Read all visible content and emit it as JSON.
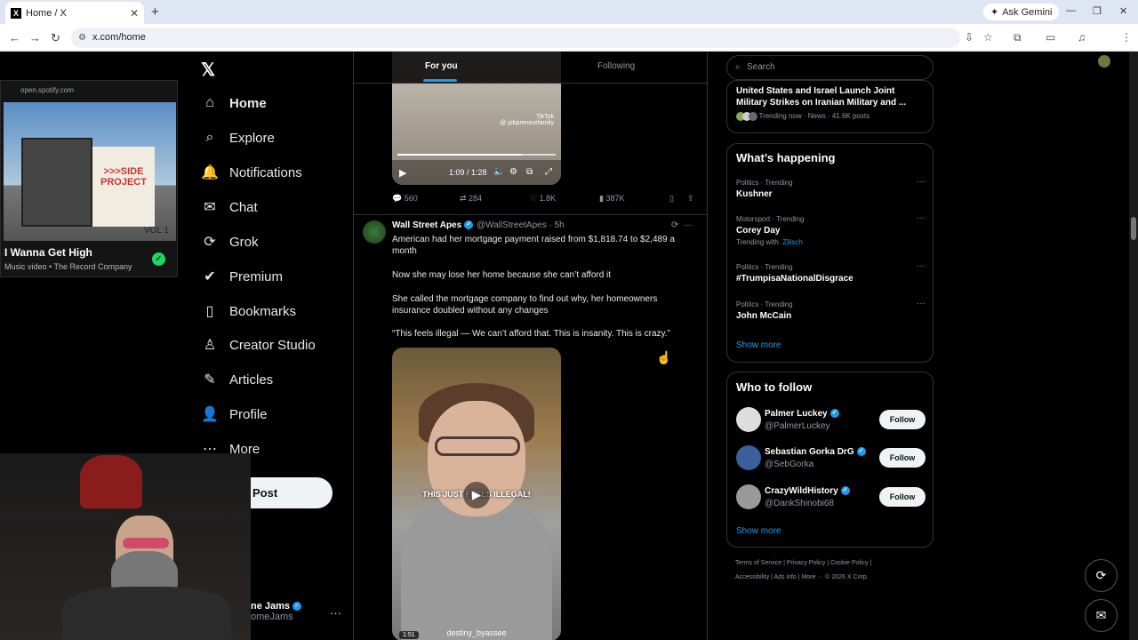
{
  "browser": {
    "tab_title": "Home / X",
    "tab_favicon": "X",
    "url": "x.com/home",
    "ask_gemini": "Ask Gemini"
  },
  "spotify": {
    "host": "open.spotify.com",
    "art_sign": ">>>SIDE PROJECT",
    "art_vol": "VOL 1",
    "song": "I Wanna Get High",
    "meta": "Music video • The Record Company"
  },
  "nav": {
    "items": [
      {
        "label": "Home",
        "icon": "home-icon"
      },
      {
        "label": "Explore",
        "icon": "search-icon"
      },
      {
        "label": "Notifications",
        "icon": "bell-icon"
      },
      {
        "label": "Chat",
        "icon": "mail-icon"
      },
      {
        "label": "Grok",
        "icon": "grok-icon"
      },
      {
        "label": "Premium",
        "icon": "verified-icon"
      },
      {
        "label": "Bookmarks",
        "icon": "bookmark-icon"
      },
      {
        "label": "Creator Studio",
        "icon": "creator-icon"
      },
      {
        "label": "Articles",
        "icon": "articles-icon"
      },
      {
        "label": "Profile",
        "icon": "user-icon"
      },
      {
        "label": "More",
        "icon": "more-icon"
      }
    ],
    "post_label": "Post",
    "account_name": "ne Jams",
    "account_handle": "omeJams"
  },
  "feed": {
    "tab_for_you": "For you",
    "tab_following": "Following",
    "video1": {
      "time": "1:09 / 1:28",
      "tiktok": "TikTok",
      "tiktok_handle": "@ jobpreneurfamily"
    },
    "prev_actions": {
      "replies": "560",
      "reposts": "284",
      "likes": "1.8K",
      "views": "387K"
    },
    "tweet": {
      "name": "Wall Street Apes",
      "handle": "@WallStreetApes · 5h",
      "p1": "American had her mortgage payment raised from $1,818.74 to $2,489 a month",
      "p2": "Now she may lose her home because she can’t afford it",
      "p3": "She called the mortgage company to find out why, her homeowners insurance doubled without any changes",
      "p4": "“This feels illegal — We can’t afford that. This is insanity. This is crazy.”",
      "video_caption": "THIS JUST FEELS ILLEGAL!",
      "video_duration": "1:51",
      "video_user": "destiny_byassee"
    }
  },
  "right": {
    "search_placeholder": "Search",
    "news": {
      "title": "United States and Israel Launch Joint Military Strikes on Iranian Military and ...",
      "meta": "Trending now · News · 41.6K posts"
    },
    "happening_title": "What’s happening",
    "trends": [
      {
        "cat": "Politics · Trending",
        "name": "Kushner",
        "with": ""
      },
      {
        "cat": "Motorsport · Trending",
        "name": "Corey Day",
        "with_label": "Trending with",
        "with": "Zilisch"
      },
      {
        "cat": "Politics · Trending",
        "name": "#TrumpisaNationalDisgrace",
        "with": ""
      },
      {
        "cat": "Politics · Trending",
        "name": "John McCain",
        "with": ""
      }
    ],
    "show_more": "Show more",
    "wtf_title": "Who to follow",
    "follow": [
      {
        "name": "Palmer Luckey",
        "handle": "@PalmerLuckey"
      },
      {
        "name": "Sebastian Gorka DrG",
        "handle": "@SebGorka"
      },
      {
        "name": "CrazyWildHistory",
        "handle": "@DankShinobi68"
      }
    ],
    "follow_label": "Follow",
    "footer_line1": "Terms of Service  |  Privacy Policy  |  Cookie Policy  |",
    "footer_line2": "Accessibility  |  Ads info  |  More ···  © 2026 X Corp."
  }
}
